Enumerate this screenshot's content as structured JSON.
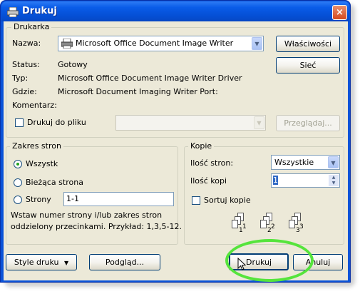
{
  "window": {
    "title": "Drukuj",
    "close_symbol": "×"
  },
  "printer": {
    "group_label": "Drukarka",
    "name_label": "Nazwa:",
    "name_value": "Microsoft Office Document Image Writer",
    "properties_button": "Właściwości",
    "network_button": "Sieć",
    "status_label": "Status:",
    "status_value": "Gotowy",
    "type_label": "Typ:",
    "type_value": "Microsoft Office Document Image Writer Driver",
    "where_label": "Gdzie:",
    "where_value": "Microsoft Document Imaging Writer Port:",
    "comment_label": "Komentarz:",
    "print_to_file_label": "Drukuj do pliku",
    "browse_button": "Przeglądaj..."
  },
  "page_range": {
    "group_label": "Zakres stron",
    "all_label": "Wszystk",
    "current_label": "Bieżąca strona",
    "pages_label": "Strony",
    "pages_value": "1-1",
    "hint_line1": "Wstaw numer strony i/lub zakres stron",
    "hint_line2": "oddzielony przecinkami. Przykład: 1,3,5-12."
  },
  "copies": {
    "group_label": "Kopie",
    "pages_count_label": "Ilość stron:",
    "pages_count_value": "Wszystkie",
    "copies_label": "Ilość kopi",
    "copies_value": "1",
    "collate_label": "Sortuj kopie",
    "collate_pages": [
      "1",
      "1",
      "2",
      "2",
      "3",
      "3"
    ]
  },
  "buttons": {
    "style": "Style druku",
    "preview": "Podgląd...",
    "print": "Drukuj",
    "cancel": "Anuluj"
  },
  "colors": {
    "accent_green": "#55e43c",
    "title_blue": "#0550d6"
  }
}
